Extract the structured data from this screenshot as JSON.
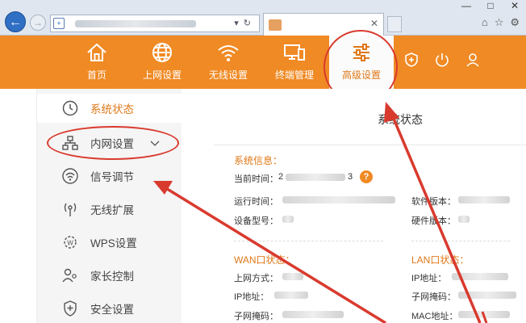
{
  "browser": {
    "back_icon": "back-arrow-icon",
    "forward_icon": "forward-arrow-icon",
    "window_controls": [
      "—",
      "□",
      "✕"
    ]
  },
  "header": {
    "nav": [
      {
        "label": "首页",
        "icon": "home-icon"
      },
      {
        "label": "上网设置",
        "icon": "globe-icon"
      },
      {
        "label": "无线设置",
        "icon": "wifi-icon"
      },
      {
        "label": "终端管理",
        "icon": "devices-icon"
      },
      {
        "label": "高级设置",
        "icon": "sliders-icon",
        "active": true
      }
    ],
    "right_icons": [
      "shield-plus-icon",
      "power-icon",
      "user-icon"
    ]
  },
  "sidebar": {
    "items": [
      {
        "label": "系统状态",
        "icon": "clock-icon",
        "active": true
      },
      {
        "label": "内网设置",
        "icon": "network-icon",
        "expandable": true
      },
      {
        "label": "信号调节",
        "icon": "signal-icon"
      },
      {
        "label": "无线扩展",
        "icon": "antenna-icon"
      },
      {
        "label": "WPS设置",
        "icon": "wps-icon"
      },
      {
        "label": "家长控制",
        "icon": "parent-icon"
      },
      {
        "label": "安全设置",
        "icon": "shield-plus-icon"
      }
    ]
  },
  "main": {
    "title": "系统状态",
    "system_info": {
      "heading": "系统信息：",
      "current_time": "当前时间：",
      "run_time": "运行时间：",
      "device_model": "设备型号：",
      "software_version": "软件版本：",
      "hardware_version": "硬件版本：",
      "time_partial_a": "2",
      "time_partial_b": "3"
    },
    "wan": {
      "heading": "WAN口状态：",
      "connection_type": "上网方式：",
      "ip": "IP地址：",
      "subnet": "子网掩码："
    },
    "lan": {
      "heading": "LAN口状态：",
      "ip": "IP地址：",
      "subnet": "子网掩码：",
      "mac": "MAC地址："
    }
  },
  "colors": {
    "brand_orange": "#f08a24",
    "accent_text": "#e07818",
    "annotation_red": "#d93a2e"
  }
}
